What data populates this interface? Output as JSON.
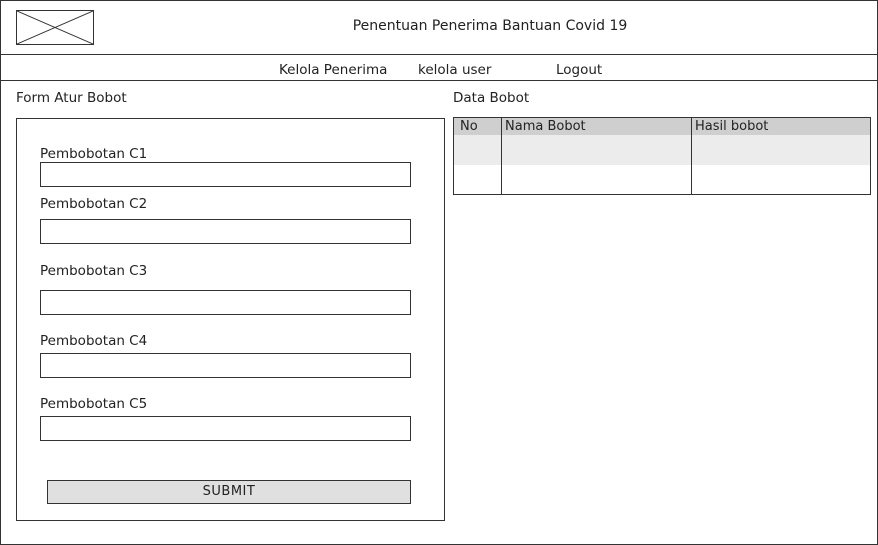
{
  "header": {
    "title": "Penentuan Penerima Bantuan Covid 19"
  },
  "nav": {
    "items": [
      {
        "label": "Kelola Penerima"
      },
      {
        "label": "kelola user"
      },
      {
        "label": "Logout"
      }
    ]
  },
  "form": {
    "title": "Form Atur Bobot",
    "fields": [
      {
        "label": "Pembobotan C1",
        "value": ""
      },
      {
        "label": "Pembobotan C2",
        "value": ""
      },
      {
        "label": "Pembobotan C3",
        "value": ""
      },
      {
        "label": "Pembobotan C4",
        "value": ""
      },
      {
        "label": "Pembobotan C5",
        "value": ""
      }
    ],
    "submit_label": "SUBMIT"
  },
  "table": {
    "title": "Data Bobot",
    "columns": [
      "No",
      "Nama Bobot",
      "Hasil bobot"
    ],
    "rows": [
      [
        "",
        "",
        ""
      ],
      [
        "",
        "",
        ""
      ]
    ]
  },
  "icons": {
    "logo": "image-placeholder-icon"
  },
  "colors": {
    "border": "#333333",
    "header_row": "#cfcfcf",
    "alt_row": "#ececec",
    "button": "#e0e0e0"
  }
}
